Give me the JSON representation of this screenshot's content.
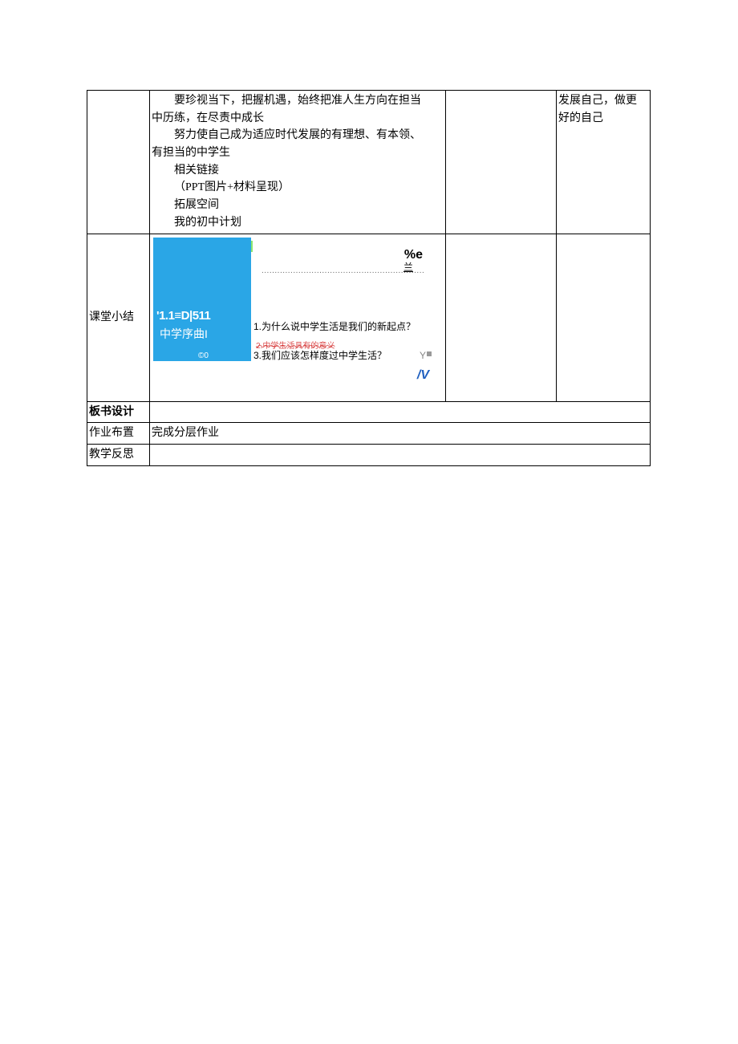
{
  "row1": {
    "col2": {
      "line1": "要珍视当下，把握机遇，始终把准人生方向在担当",
      "line2": "中历练，在尽责中成长",
      "line3": "努力使自己成为适应时代发展的有理想、有本领、",
      "line4": "有担当的中学生",
      "line5": "相关链接",
      "line6": "",
      "line7": "（PPT图片+材料呈现）",
      "line8": "拓展空间",
      "line9": "我的初中计划"
    },
    "col4": {
      "line1": "发展自己，做更",
      "line2": "好的自己"
    }
  },
  "row2": {
    "label": "课堂小结",
    "slide": {
      "blue_title1": "'1.1≡D|511",
      "blue_title2": "中学序曲I",
      "blue_dot": "©0",
      "pe": "%e",
      "dots": "..............................................................",
      "lan": "兰",
      "q1": "1.为什么说中学生活是我们的新起点？",
      "q2_strike": "2.中学生活具有的意义",
      "q3": "3.我们应该怎样度过中学生活？",
      "y": "Y",
      "nv": "/V"
    }
  },
  "row3": {
    "label": "板书设计"
  },
  "row4": {
    "label": "作业布置",
    "content": "完成分层作业"
  },
  "row5": {
    "label": "教学反思"
  }
}
